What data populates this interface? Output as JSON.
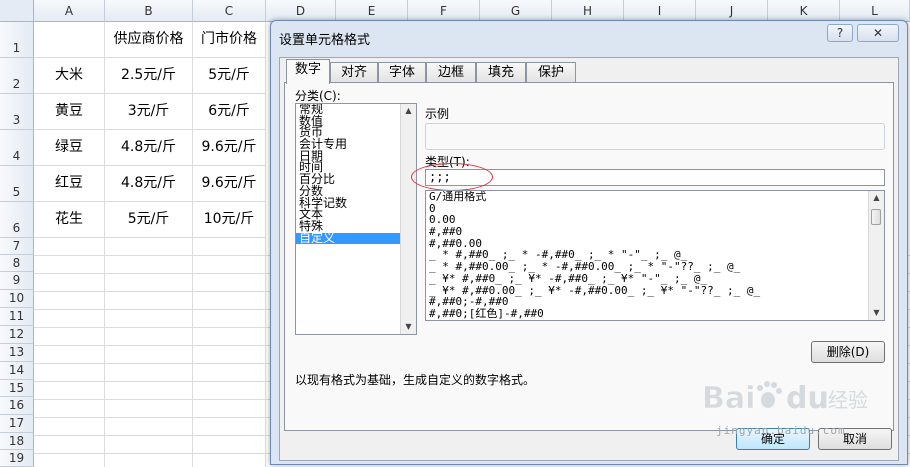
{
  "sheet": {
    "columns": [
      "A",
      "B",
      "C",
      "D",
      "E",
      "F",
      "G",
      "H",
      "I",
      "J",
      "K",
      "L"
    ],
    "header_row": [
      "",
      "供应商价格",
      "门市价格"
    ],
    "rows": [
      {
        "num": "2",
        "name": "大米",
        "supplier": "2.5元/斤",
        "retail": "5元/斤"
      },
      {
        "num": "3",
        "name": "黄豆",
        "supplier": "3元/斤",
        "retail": "6元/斤"
      },
      {
        "num": "4",
        "name": "绿豆",
        "supplier": "4.8元/斤",
        "retail": "9.6元/斤"
      },
      {
        "num": "5",
        "name": "红豆",
        "supplier": "4.8元/斤",
        "retail": "9.6元/斤"
      },
      {
        "num": "6",
        "name": "花生",
        "supplier": "5元/斤",
        "retail": "10元/斤"
      }
    ],
    "row_numbers": [
      "1",
      "2",
      "3",
      "4",
      "5",
      "6",
      "7",
      "8",
      "9",
      "10",
      "11",
      "12",
      "13",
      "14",
      "15",
      "16",
      "17",
      "18",
      "19"
    ]
  },
  "dialog": {
    "title": "设置单元格格式",
    "help_glyph": "?",
    "close_glyph": "✕",
    "tabs": [
      "数字",
      "对齐",
      "字体",
      "边框",
      "填充",
      "保护"
    ],
    "active_tab": "数字",
    "category_label": "分类(C):",
    "categories": [
      "常规",
      "数值",
      "货币",
      "会计专用",
      "日期",
      "时间",
      "百分比",
      "分数",
      "科学记数",
      "文本",
      "特殊",
      "自定义"
    ],
    "selected_category": "自定义",
    "sample_label": "示例",
    "type_label": "类型(T):",
    "type_value": ";;;",
    "format_list": [
      "G/通用格式",
      "0",
      "0.00",
      "#,##0",
      "#,##0.00",
      "_ * #,##0_ ;_ * -#,##0_ ;_ * \"-\"_ ;_ @_",
      "_ * #,##0.00_ ;_ * -#,##0.00_ ;_ * \"-\"??_ ;_ @_",
      "_ ¥* #,##0_ ;_ ¥* -#,##0_ ;_ ¥* \"-\"_ ;_ @_",
      "_ ¥* #,##0.00_ ;_ ¥* -#,##0.00_ ;_ ¥* \"-\"??_ ;_ @_",
      "#,##0;-#,##0",
      "#,##0;[红色]-#,##0"
    ],
    "delete_label": "删除(D)",
    "description": "以现有格式为基础，生成自定义的数字格式。",
    "ok_label": "确定",
    "cancel_label": "取消",
    "annotation_color": "#d9363e"
  },
  "watermark": {
    "text": "jingyan.baidu.com",
    "brand": "Bai du 经验"
  }
}
